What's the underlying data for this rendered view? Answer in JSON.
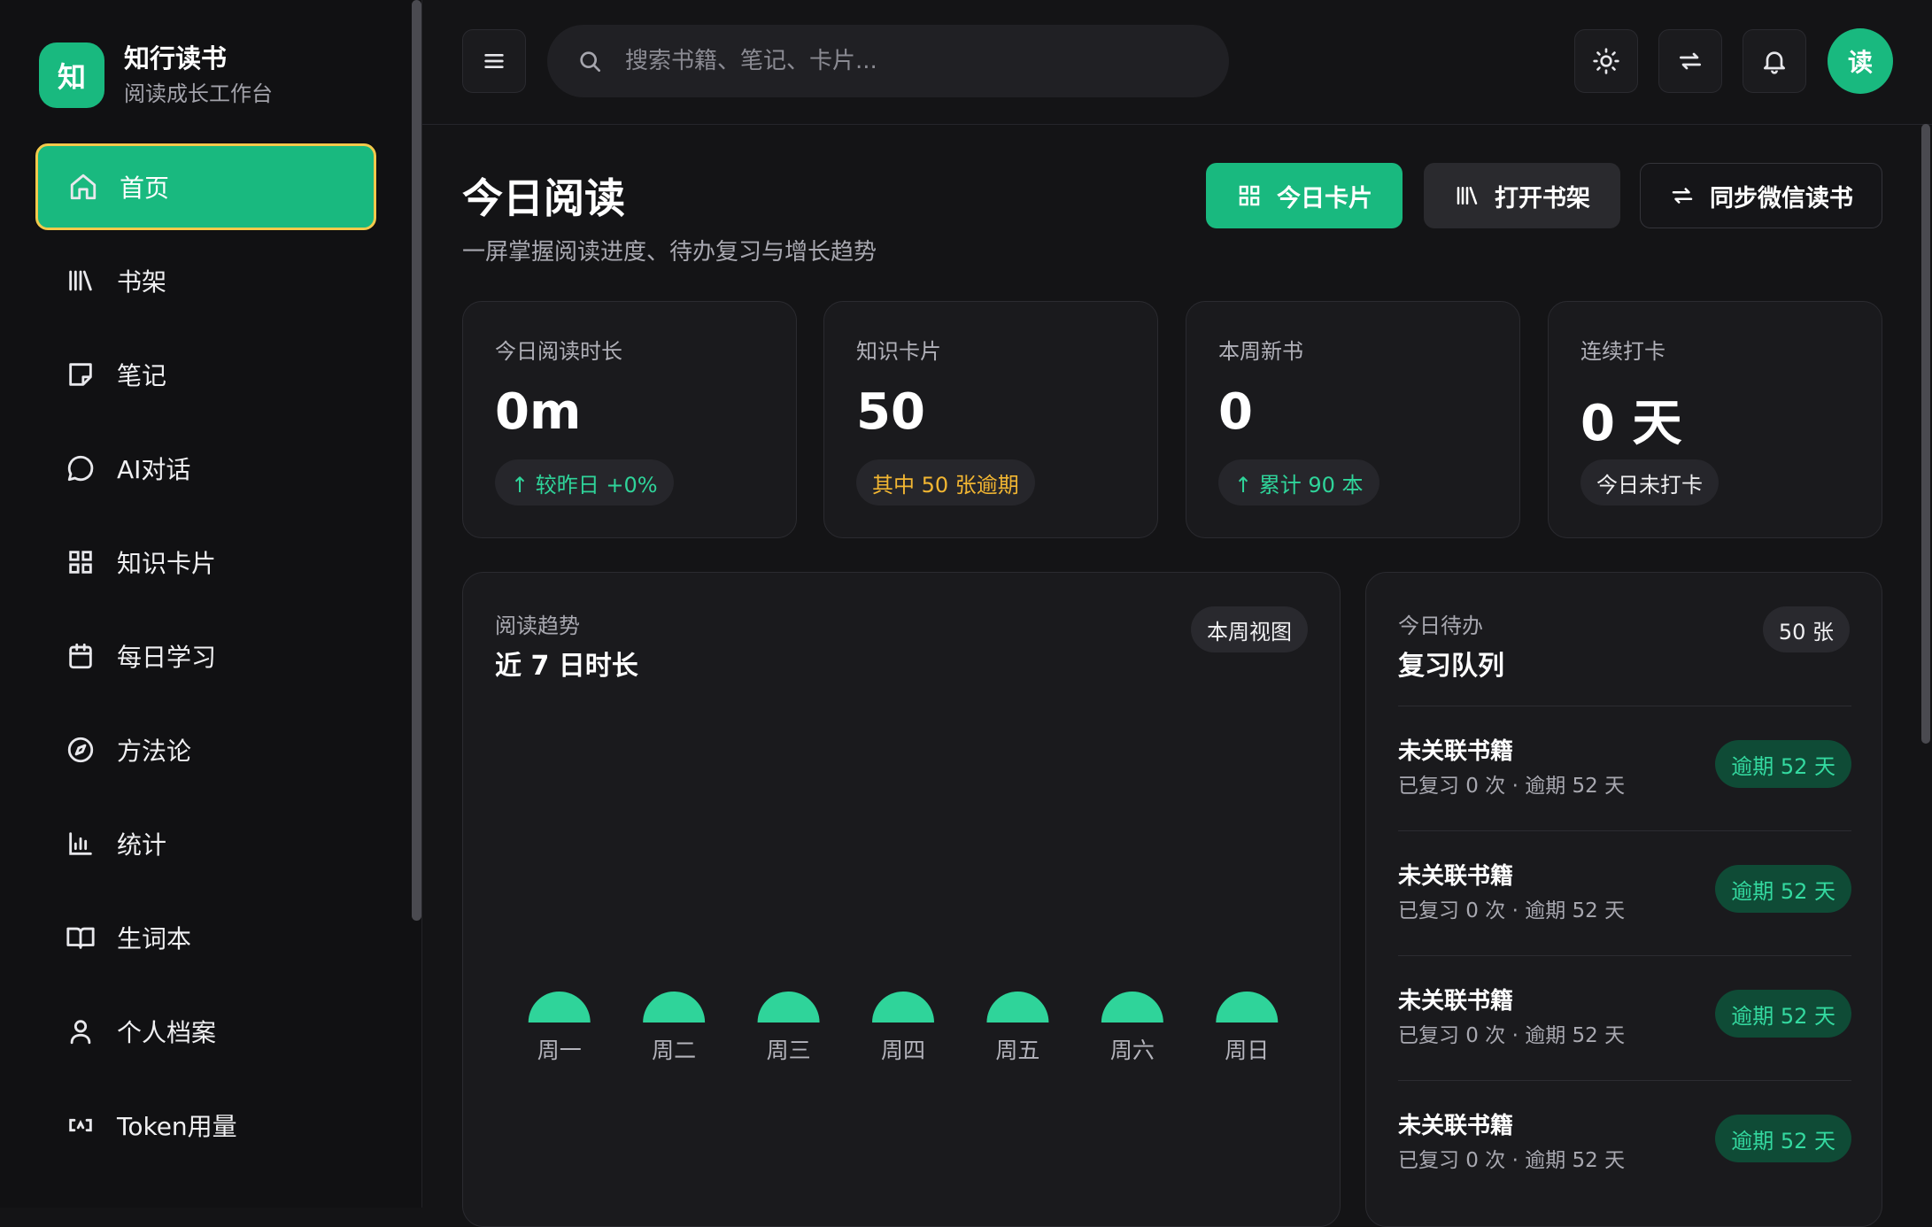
{
  "brand": {
    "logo": "知",
    "name": "知行读书",
    "subtitle": "阅读成长工作台"
  },
  "nav": [
    {
      "label": "首页",
      "icon": "home-icon",
      "active": true
    },
    {
      "label": "书架",
      "icon": "library-icon"
    },
    {
      "label": "笔记",
      "icon": "note-icon"
    },
    {
      "label": "AI对话",
      "icon": "chat-icon"
    },
    {
      "label": "知识卡片",
      "icon": "grid-icon"
    },
    {
      "label": "每日学习",
      "icon": "calendar-icon"
    },
    {
      "label": "方法论",
      "icon": "compass-icon"
    },
    {
      "label": "统计",
      "icon": "bar-chart-icon"
    },
    {
      "label": "生词本",
      "icon": "book-open-icon"
    },
    {
      "label": "个人档案",
      "icon": "user-icon"
    },
    {
      "label": "Token用量",
      "icon": "token-icon"
    }
  ],
  "header": {
    "search_placeholder": "搜索书籍、笔记、卡片...",
    "avatar": "读"
  },
  "page": {
    "title": "今日阅读",
    "subtitle": "一屏掌握阅读进度、待办复习与增长趋势",
    "actions": {
      "cards": "今日卡片",
      "shelf": "打开书架",
      "sync": "同步微信读书"
    }
  },
  "stats": [
    {
      "label": "今日阅读时长",
      "value": "0m",
      "pill": "↑ 较昨日 +0%",
      "tone": "green"
    },
    {
      "label": "知识卡片",
      "value": "50",
      "pill": "其中 50 张逾期",
      "tone": "amber"
    },
    {
      "label": "本周新书",
      "value": "0",
      "pill": "↑ 累计 90 本",
      "tone": "green"
    },
    {
      "label": "连续打卡",
      "value": "0 天",
      "pill": "今日未打卡",
      "tone": "white"
    }
  ],
  "trend": {
    "kicker": "阅读趋势",
    "title": "近 7 日时长",
    "badge": "本周视图"
  },
  "queue": {
    "kicker": "今日待办",
    "title": "复习队列",
    "badge": "50 张",
    "items": [
      {
        "title": "未关联书籍",
        "meta": "已复习 0 次 · 逾期 52 天",
        "tag": "逾期 52 天"
      },
      {
        "title": "未关联书籍",
        "meta": "已复习 0 次 · 逾期 52 天",
        "tag": "逾期 52 天"
      },
      {
        "title": "未关联书籍",
        "meta": "已复习 0 次 · 逾期 52 天",
        "tag": "逾期 52 天"
      },
      {
        "title": "未关联书籍",
        "meta": "已复习 0 次 · 逾期 52 天",
        "tag": "逾期 52 天"
      }
    ]
  },
  "colors": {
    "accent": "#19b97f",
    "bar": "#2fd49a",
    "focus_ring": "#f2c94c",
    "overdue_bg": "#0f4b36",
    "overdue_text": "#34d9a0"
  },
  "chart_data": {
    "type": "bar",
    "categories": [
      "周一",
      "周二",
      "周三",
      "周四",
      "周五",
      "周六",
      "周日"
    ],
    "values": [
      0,
      0,
      0,
      0,
      0,
      0,
      0
    ]
  }
}
